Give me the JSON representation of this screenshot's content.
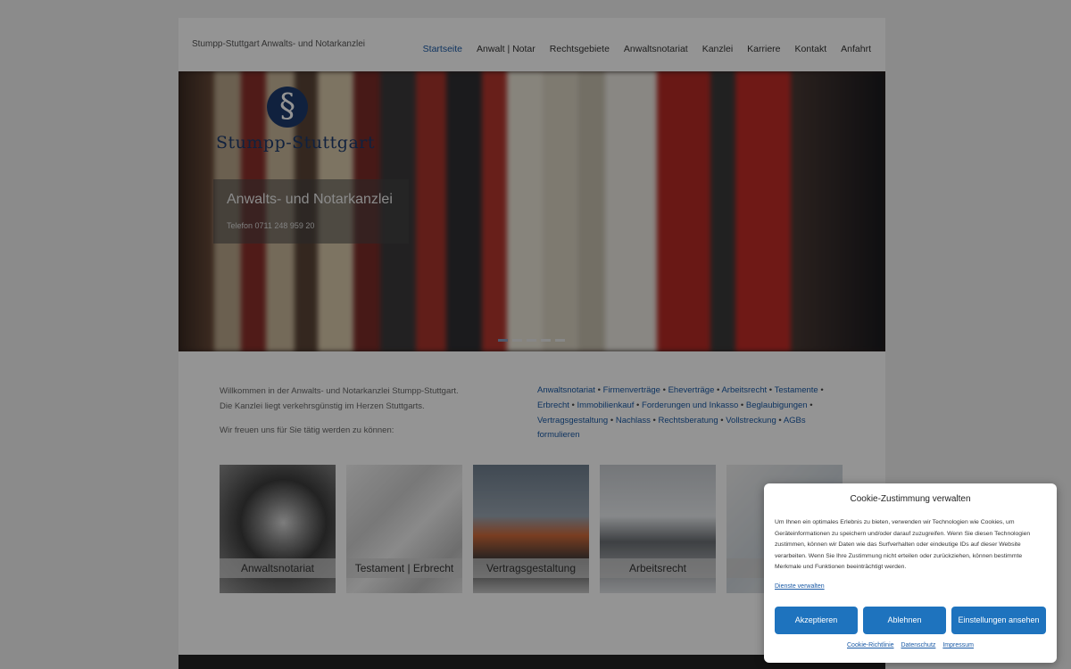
{
  "header": {
    "site_title": "Stumpp-Stuttgart Anwalts- und Notarkanzlei",
    "nav": [
      {
        "label": "Startseite",
        "active": true
      },
      {
        "label": "Anwalt | Notar"
      },
      {
        "label": "Rechtsgebiete"
      },
      {
        "label": "Anwaltsnotariat"
      },
      {
        "label": "Kanzlei"
      },
      {
        "label": "Karriere"
      },
      {
        "label": "Kontakt"
      },
      {
        "label": "Anfahrt"
      }
    ]
  },
  "hero": {
    "logo_symbol": "§",
    "logo_text": "Stumpp-Stuttgart",
    "title": "Anwalts- und Notarkanzlei",
    "phone": "Telefon 0711 248 959 20",
    "slider_dots": 5,
    "active_dot": 1
  },
  "intro": {
    "line1": "Willkommen in der Anwalts- und Notarkanzlei Stumpp-Stuttgart.",
    "line2": "Die Kanzlei liegt verkehrsgünstig im Herzen Stuttgarts.",
    "line3": "Wir freuen uns für Sie tätig werden zu können:"
  },
  "tags": [
    "Anwaltsnotariat",
    "Firmenverträge",
    "Eheverträge",
    "Arbeitsrecht",
    "Testamente",
    "Erbrecht",
    "Immobilienkauf",
    "Forderungen und Inkasso",
    "Beglaubigungen",
    "Vertragsgestaltung",
    "Nachlass",
    "Rechtsberatung",
    "Vollstreckung",
    "AGBs formulieren"
  ],
  "tiles": [
    {
      "label": "Anwaltsnotariat"
    },
    {
      "label": "Testament | Erbrecht"
    },
    {
      "label": "Vertragsgestaltung"
    },
    {
      "label": "Arbeitsrecht"
    },
    {
      "label": "Fo"
    }
  ],
  "cookie": {
    "title": "Cookie-Zustimmung verwalten",
    "text": "Um Ihnen ein optimales Erlebnis zu bieten, verwenden wir Technologien wie Cookies, um Geräteinformationen zu speichern und/oder darauf zuzugreifen. Wenn Sie diesen Technologien zustimmen, können wir Daten wie das Surfverhalten oder eindeutige IDs auf dieser Website verarbeiten. Wenn Sie Ihre Zustimmung nicht erteilen oder zurückziehen, können bestimmte Merkmale und Funktionen beeinträchtigt werden.",
    "manage_link": "Dienste verwalten",
    "accept": "Akzeptieren",
    "reject": "Ablehnen",
    "settings": "Einstellungen ansehen",
    "footer_links": [
      "Cookie-Richtlinie",
      "Datenschutz",
      "Impressum"
    ]
  },
  "colors": {
    "accent": "#1e73be",
    "link": "#1a5aa6",
    "logo_blue": "#1d3a6b"
  }
}
